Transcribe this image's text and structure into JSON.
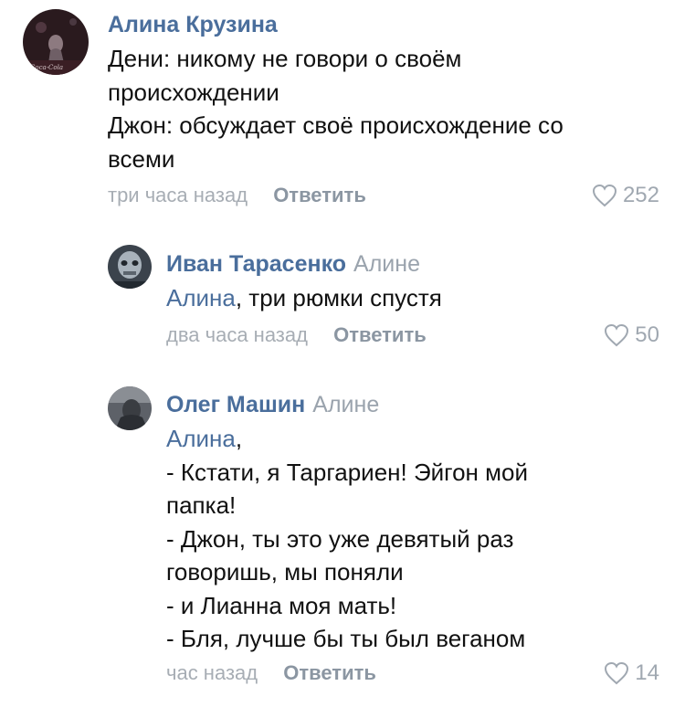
{
  "comments": [
    {
      "author": "Алина Крузина",
      "reply_to": "",
      "mention": "",
      "lines": [
        "Дени: никому не говори о своём",
        "происхождении",
        "Джон: обсуждает своё происхождение со",
        "всеми"
      ],
      "time": "три часа назад",
      "reply_label": "Ответить",
      "likes": "252",
      "avatar_badge": "Coca-Cola"
    },
    {
      "author": "Иван Тарасенко",
      "reply_to": "Алине",
      "mention": "Алина",
      "lines": [
        ", три рюмки спустя"
      ],
      "time": "два часа назад",
      "reply_label": "Ответить",
      "likes": "50"
    },
    {
      "author": "Олег Машин",
      "reply_to": "Алине",
      "mention": "Алина",
      "lines": [
        ",",
        "- Кстати, я Таргариен! Эйгон мой",
        "папка!",
        "- Джон, ты это уже девятый раз",
        "говоришь, мы поняли",
        "- и Лианна моя мать!",
        "- Бля, лучше бы ты был веганом"
      ],
      "time": "час назад",
      "reply_label": "Ответить",
      "likes": "14"
    }
  ],
  "colors": {
    "author": "#4a6e9c",
    "meta": "#a7adb4",
    "reply_button": "#8b96a2",
    "body": "#111111"
  },
  "icons": {
    "likes": "heart-outline-icon"
  }
}
